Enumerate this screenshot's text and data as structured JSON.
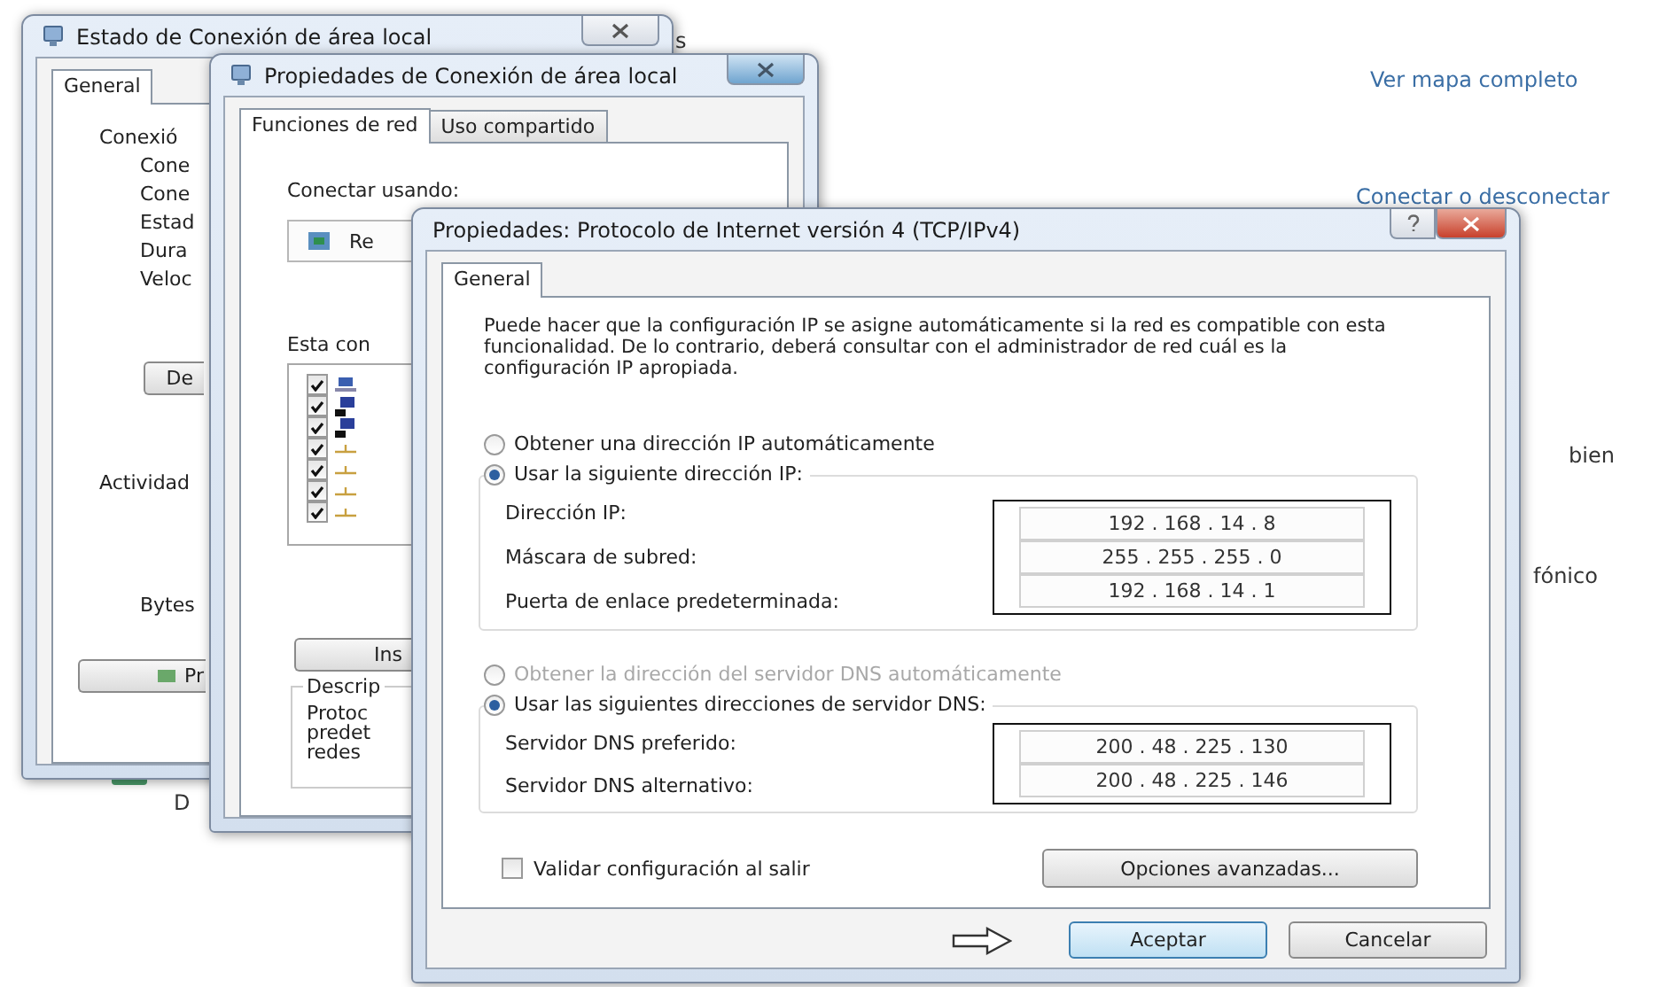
{
  "background_page": {
    "links": [
      {
        "label": "Ver mapa completo"
      },
      {
        "label": "Conectar o desconectar"
      }
    ],
    "texts": [
      "s",
      "bien",
      "fónico",
      "D"
    ]
  },
  "status_window": {
    "title": "Estado de Conexión de área local",
    "tabs": [
      {
        "label": "General",
        "selected": true
      }
    ],
    "connection_heading": "Conexió",
    "connection_rows": [
      "Cone",
      "Cone",
      "Estad",
      "Dura",
      "Veloc"
    ],
    "details_button": "De",
    "activity_heading": "Actividad",
    "bytes_label": "Bytes",
    "properties_button": "Pr"
  },
  "properties_window": {
    "title": "Propiedades de Conexión de área local",
    "tabs": [
      {
        "label": "Funciones de red",
        "selected": true
      },
      {
        "label": "Uso compartido",
        "selected": false
      }
    ],
    "connect_using_label": "Conectar usando:",
    "adapter": "Re",
    "components_label": "Esta con",
    "components": [
      {
        "kind": "client",
        "checked": true
      },
      {
        "kind": "computer",
        "checked": true
      },
      {
        "kind": "computer",
        "checked": true
      },
      {
        "kind": "protocol",
        "checked": true
      },
      {
        "kind": "protocol",
        "checked": true
      },
      {
        "kind": "protocol",
        "checked": true
      },
      {
        "kind": "protocol",
        "checked": true
      }
    ],
    "install_button": "Ins",
    "description_group": "Descrip",
    "description_lines": [
      "Protoc",
      "predet",
      "redes"
    ]
  },
  "ipv4_window": {
    "title": "Propiedades: Protocolo de Internet versión 4 (TCP/IPv4)",
    "tabs": [
      {
        "label": "General",
        "selected": true
      }
    ],
    "intro": "Puede hacer que la configuración IP se asigne automáticamente si la red es compatible con esta funcionalidad. De lo contrario, deberá consultar con el administrador de red cuál es la configuración IP apropiada.",
    "ip_options": [
      {
        "label": "Obtener una dirección IP automáticamente",
        "selected": false,
        "disabled": false
      },
      {
        "label": "Usar la siguiente dirección IP:",
        "selected": true,
        "disabled": false
      }
    ],
    "ip_fields": [
      {
        "label": "Dirección IP:",
        "value": "192 . 168 . 14 . 8"
      },
      {
        "label": "Máscara de subred:",
        "value": "255 . 255 . 255 . 0"
      },
      {
        "label": "Puerta de enlace predeterminada:",
        "value": "192 . 168 . 14 . 1"
      }
    ],
    "dns_options": [
      {
        "label": "Obtener la dirección del servidor DNS automáticamente",
        "selected": false,
        "disabled": true
      },
      {
        "label": "Usar las siguientes direcciones de servidor DNS:",
        "selected": true,
        "disabled": false
      }
    ],
    "dns_fields": [
      {
        "label": "Servidor DNS preferido:",
        "value": "200 . 48 . 225 . 130"
      },
      {
        "label": "Servidor DNS alternativo:",
        "value": "200 . 48 . 225 . 146"
      }
    ],
    "validate": {
      "label": "Validar configuración al salir",
      "checked": false
    },
    "advanced_button": "Opciones avanzadas...",
    "ok_button": "Aceptar",
    "cancel_button": "Cancelar"
  }
}
